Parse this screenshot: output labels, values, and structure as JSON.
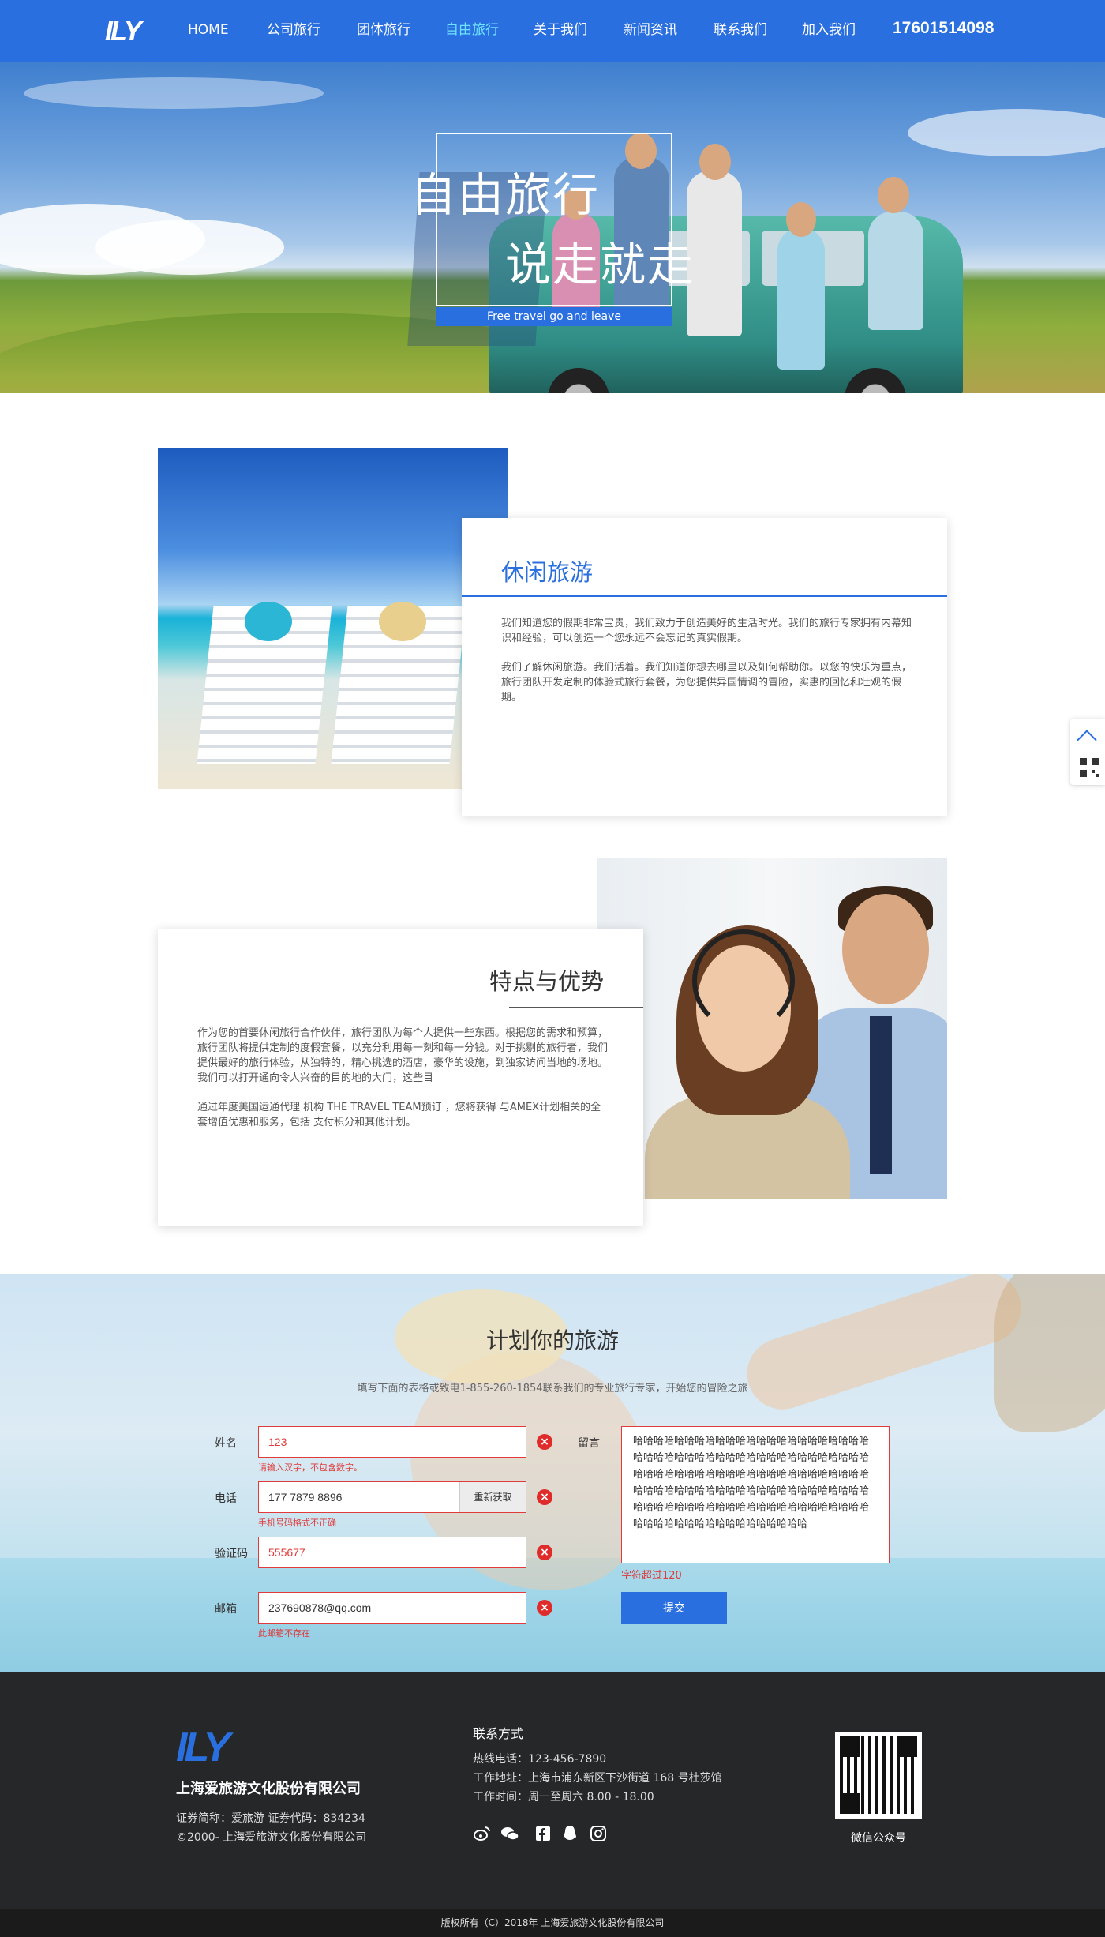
{
  "nav": {
    "logo": "ILY",
    "items": [
      {
        "label": "HOME"
      },
      {
        "label": "公司旅行"
      },
      {
        "label": "团体旅行"
      },
      {
        "label": "自由旅行"
      },
      {
        "label": "关于我们"
      },
      {
        "label": "新闻资讯"
      },
      {
        "label": "联系我们"
      },
      {
        "label": "加入我们"
      }
    ],
    "active_index": 3,
    "phone": "17601514098"
  },
  "hero": {
    "title_line1": "自由旅行",
    "title_line2": "说走就走",
    "subtitle": "Free travel go and leave"
  },
  "leisure": {
    "title": "休闲旅游",
    "paragraph1": "我们知道您的假期非常宝贵，我们致力于创造美好的生活时光。我们的旅行专家拥有内幕知识和经验，可以创造一个您永远不会忘记的真实假期。",
    "paragraph2": "我们了解休闲旅游。我们活着。我们知道你想去哪里以及如何帮助你。以您的快乐为重点，旅行团队开发定制的体验式旅行套餐，为您提供异国情调的冒险，实惠的回忆和壮观的假期。"
  },
  "features": {
    "title": "特点与优势",
    "paragraph1": "作为您的首要休闲旅行合作伙伴，旅行团队为每个人提供一些东西。根据您的需求和预算，旅行团队将提供定制的度假套餐，以充分利用每一刻和每一分钱。对于挑剔的旅行者，我们提供最好的旅行体验，从独特的，精心挑选的酒店，豪华的设施，到独家访问当地的场地。我们可以打开通向令人兴奋的目的地的大门，这些目",
    "paragraph2": "通过年度美国运通代理 机构 THE TRAVEL TEAM预订 ，您将获得 与AMEX计划相关的全套增值优惠和服务，包括 支付积分和其他计划。"
  },
  "plan": {
    "title": "计划你的旅游",
    "subtitle": "填写下面的表格或致电1-855-260-1854联系我们的专业旅行专家，开始您的冒险之旅",
    "name_label": "姓名",
    "name_value": "123",
    "name_error": "请输入汉字，不包含数字。",
    "phone_label": "电话",
    "phone_value": "177 7879 8896",
    "phone_button": "重新获取",
    "phone_error": "手机号码格式不正确",
    "code_label": "验证码",
    "code_value": "555677",
    "email_label": "邮箱",
    "email_value": "237690878@qq.com",
    "email_error": "此邮箱不存在",
    "message_label": "留言",
    "message_value": "哈哈哈哈哈哈哈哈哈哈哈哈哈哈哈哈哈哈哈哈哈哈哈哈哈哈哈哈哈哈哈哈哈哈哈哈哈哈哈哈哈哈哈哈哈哈哈哈哈哈哈哈哈哈哈哈哈哈哈哈哈哈哈哈哈哈哈哈哈哈哈哈哈哈哈哈哈哈哈哈哈哈哈哈哈哈哈哈哈哈哈哈哈哈哈哈哈哈哈哈哈哈哈哈哈哈哈哈哈哈哈哈哈哈哈哈哈哈哈哈哈哈哈哈哈哈哈哈哈哈哈哈",
    "message_error": "字符超过120",
    "error_icon": "×",
    "submit": "提交"
  },
  "footer": {
    "logo": "ILY",
    "company": "上海爱旅游文化股份有限公司",
    "stock": "证券简称：爱旅游 证券代码：834234",
    "since": "©2000- 上海爱旅游文化股份有限公司",
    "contact_title": "联系方式",
    "hotline": "热线电话：123-456-7890",
    "address": "工作地址：上海市浦东新区下沙街道 168 号杜莎馆",
    "hours": "工作时间：周一至周六 8.00 - 18.00",
    "social_icons": [
      "weibo-icon",
      "wechat-icon",
      "facebook-icon",
      "qq-icon",
      "instagram-icon"
    ],
    "qr_label": "微信公众号",
    "copyright": "版权所有（C）2018年 上海爱旅游文化股份有限公司"
  },
  "colors": {
    "brand_blue": "#2a6fe0",
    "active_nav": "#6ee3ff",
    "error_red": "#e03a3a",
    "footer_bg": "#262728"
  }
}
